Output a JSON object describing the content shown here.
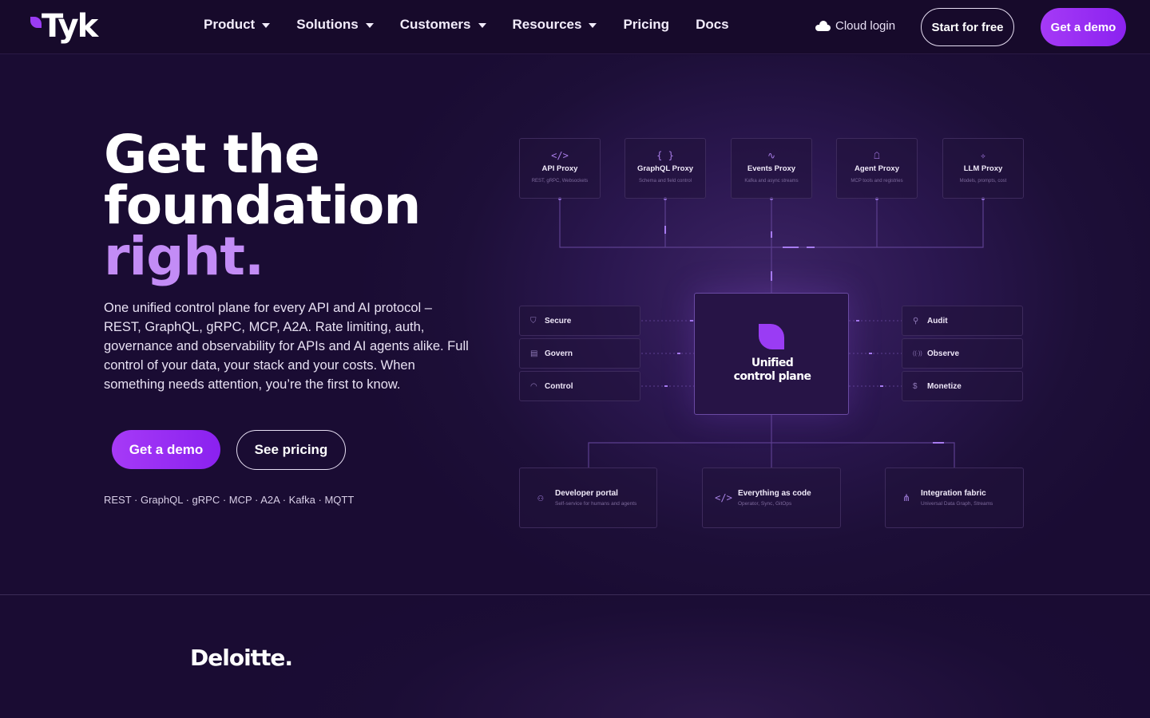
{
  "nav": {
    "logo_text": "Tyk",
    "links": [
      {
        "label": "Product",
        "dropdown": true
      },
      {
        "label": "Solutions",
        "dropdown": true
      },
      {
        "label": "Customers",
        "dropdown": true
      },
      {
        "label": "Resources",
        "dropdown": true
      },
      {
        "label": "Pricing",
        "dropdown": false
      },
      {
        "label": "Docs",
        "dropdown": false
      }
    ],
    "cloud_login": "Cloud login",
    "start_free": "Start for free",
    "get_demo": "Get a demo"
  },
  "hero": {
    "headline_line1": "Get the",
    "headline_line2": "foundation",
    "headline_accent": "right.",
    "subtext": "One unified control plane for every API and AI protocol – REST, GraphQL, gRPC, MCP, A2A. Rate limiting, auth, governance and observability for APIs and AI agents alike. Full control of your data, your stack and your costs. When something needs attention, you’re the first to know.",
    "cta_demo": "Get a demo",
    "cta_pricing": "See pricing",
    "protocols": "REST · GraphQL · gRPC · MCP · A2A · Kafka · MQTT"
  },
  "diagram": {
    "proxies": [
      {
        "icon": "code-icon",
        "glyph": "</>",
        "title": "API Proxy",
        "subtitle": "REST, gRPC, Websockets"
      },
      {
        "icon": "braces-icon",
        "glyph": "{ }",
        "title": "GraphQL Proxy",
        "subtitle": "Schema and field control"
      },
      {
        "icon": "activity-icon",
        "glyph": "∿",
        "title": "Events Proxy",
        "subtitle": "Kafka and async streams"
      },
      {
        "icon": "bot-icon",
        "glyph": "☖",
        "title": "Agent Proxy",
        "subtitle": "MCP tools and registries"
      },
      {
        "icon": "sparkle-icon",
        "glyph": "✧",
        "title": "LLM Proxy",
        "subtitle": "Models, prompts, cost"
      }
    ],
    "left": [
      {
        "icon": "shield-icon",
        "glyph": "⛉",
        "label": "Secure"
      },
      {
        "icon": "document-icon",
        "glyph": "▤",
        "label": "Govern"
      },
      {
        "icon": "gauge-icon",
        "glyph": "◠",
        "label": "Control"
      }
    ],
    "right": [
      {
        "icon": "search-icon",
        "glyph": "⚲",
        "label": "Audit"
      },
      {
        "icon": "broadcast-icon",
        "glyph": "((·))",
        "label": "Observe"
      },
      {
        "icon": "dollar-icon",
        "glyph": "$",
        "label": "Monetize"
      }
    ],
    "core_title_line1": "Unified",
    "core_title_line2": "control plane",
    "bottom": [
      {
        "icon": "users-icon",
        "glyph": "⚇",
        "title": "Developer portal",
        "subtitle": "Self-service for humans and agents"
      },
      {
        "icon": "code-icon",
        "glyph": "</>",
        "title": "Everything as code",
        "subtitle": "Operator, Sync, GitOps"
      },
      {
        "icon": "share-icon",
        "glyph": "⋔",
        "title": "Integration fabric",
        "subtitle": "Universal Data Graph, Streams"
      }
    ]
  },
  "logos": {
    "first": "Deloitte."
  },
  "colors": {
    "accent": "#9b3cf5",
    "headline_accent": "#c38cf6",
    "background": "#1a0c33"
  }
}
